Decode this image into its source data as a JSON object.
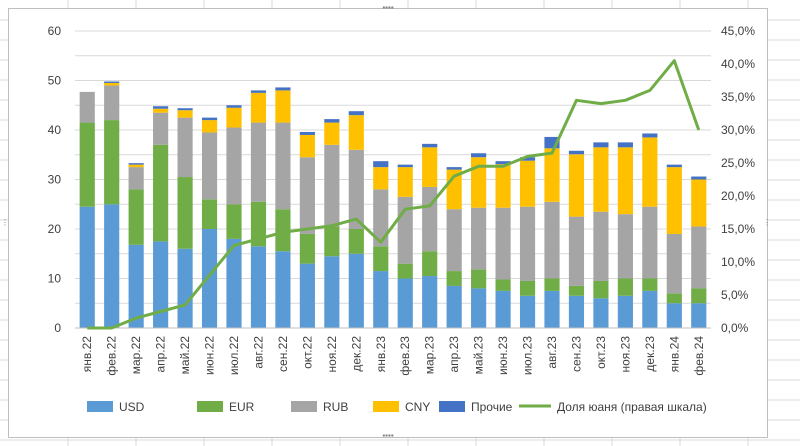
{
  "chart_data": {
    "type": "bar",
    "stacked": true,
    "categories": [
      "янв.22",
      "фев.22",
      "мар.22",
      "апр.22",
      "май.22",
      "июн.22",
      "июл.22",
      "авг.22",
      "сен.22",
      "окт.22",
      "ноя.22",
      "дек.22",
      "янв.23",
      "фев.23",
      "мар.23",
      "апр.23",
      "май.23",
      "июн.23",
      "июл.23",
      "авг.23",
      "сен.23",
      "окт.23",
      "ноя.23",
      "дек.23",
      "янв.24",
      "фев.24"
    ],
    "series": [
      {
        "name": "USD",
        "color": "#5b9bd5",
        "values": [
          24.5,
          25,
          16.8,
          17.5,
          16,
          20,
          18,
          16.5,
          15.5,
          13,
          14.5,
          15,
          11.5,
          10,
          10.5,
          8.5,
          8,
          7.5,
          6.5,
          7.5,
          6.5,
          6,
          6.5,
          7.5,
          5,
          5
        ]
      },
      {
        "name": "EUR",
        "color": "#70ad47",
        "values": [
          17,
          17,
          11.2,
          19.5,
          14.5,
          6,
          7,
          9,
          8.5,
          6,
          6,
          5,
          5,
          3,
          5,
          3,
          3.8,
          2.3,
          3,
          2.5,
          2,
          3.5,
          3.5,
          2.5,
          2,
          3
        ]
      },
      {
        "name": "RUB",
        "color": "#a5a5a5",
        "values": [
          6.2,
          7,
          4.5,
          6.5,
          12,
          13.5,
          15.5,
          16,
          17.5,
          15.5,
          16.5,
          16,
          11.5,
          13.5,
          13,
          12.5,
          12.5,
          14.5,
          15,
          15.5,
          14,
          14,
          13,
          14.5,
          12,
          12.5
        ]
      },
      {
        "name": "CNY",
        "color": "#ffc000",
        "values": [
          0,
          0.5,
          0.5,
          0.8,
          1.5,
          2.5,
          4,
          6,
          6.5,
          4.5,
          4.5,
          7,
          4.5,
          6,
          8,
          8,
          10.2,
          8.8,
          9.3,
          10.8,
          12.6,
          13,
          13.5,
          14,
          13.5,
          9.5
        ]
      },
      {
        "name": "Прочие",
        "color": "#4472c4",
        "values": [
          0,
          0.3,
          0.3,
          0.5,
          0.4,
          0.5,
          0.5,
          0.5,
          0.6,
          0.6,
          0.7,
          0.8,
          1.2,
          0.5,
          0.7,
          0.5,
          0.8,
          0.6,
          0.7,
          2.3,
          0.7,
          1,
          1,
          0.8,
          0.5,
          0.6
        ]
      }
    ],
    "line": {
      "name": "Доля юаня (правая шкала)",
      "color": "#70ad47",
      "values": [
        0,
        0,
        1.5,
        2.5,
        3.5,
        8,
        12.5,
        13.5,
        14.5,
        15,
        15.5,
        16.5,
        13,
        18,
        18.5,
        23,
        24.5,
        24.5,
        26,
        26.5,
        34.5,
        34,
        34.5,
        36,
        40.5,
        30
      ]
    },
    "y_left": {
      "min": 0,
      "max": 60,
      "step": 10,
      "ticks": [
        "0",
        "10",
        "20",
        "30",
        "40",
        "50",
        "60"
      ]
    },
    "y_right": {
      "min": 0,
      "max": 45,
      "step": 5,
      "ticks": [
        "0,0%",
        "5,0%",
        "10,0%",
        "15,0%",
        "20,0%",
        "25,0%",
        "30,0%",
        "35,0%",
        "40,0%",
        "45,0%"
      ]
    },
    "grid": true,
    "legend_position": "bottom",
    "selected_points_note": ""
  },
  "handles": {
    "top": "▪▪▪▪",
    "bottom": "▪▪▪▪",
    "left": "⋮",
    "right": "⋮"
  }
}
